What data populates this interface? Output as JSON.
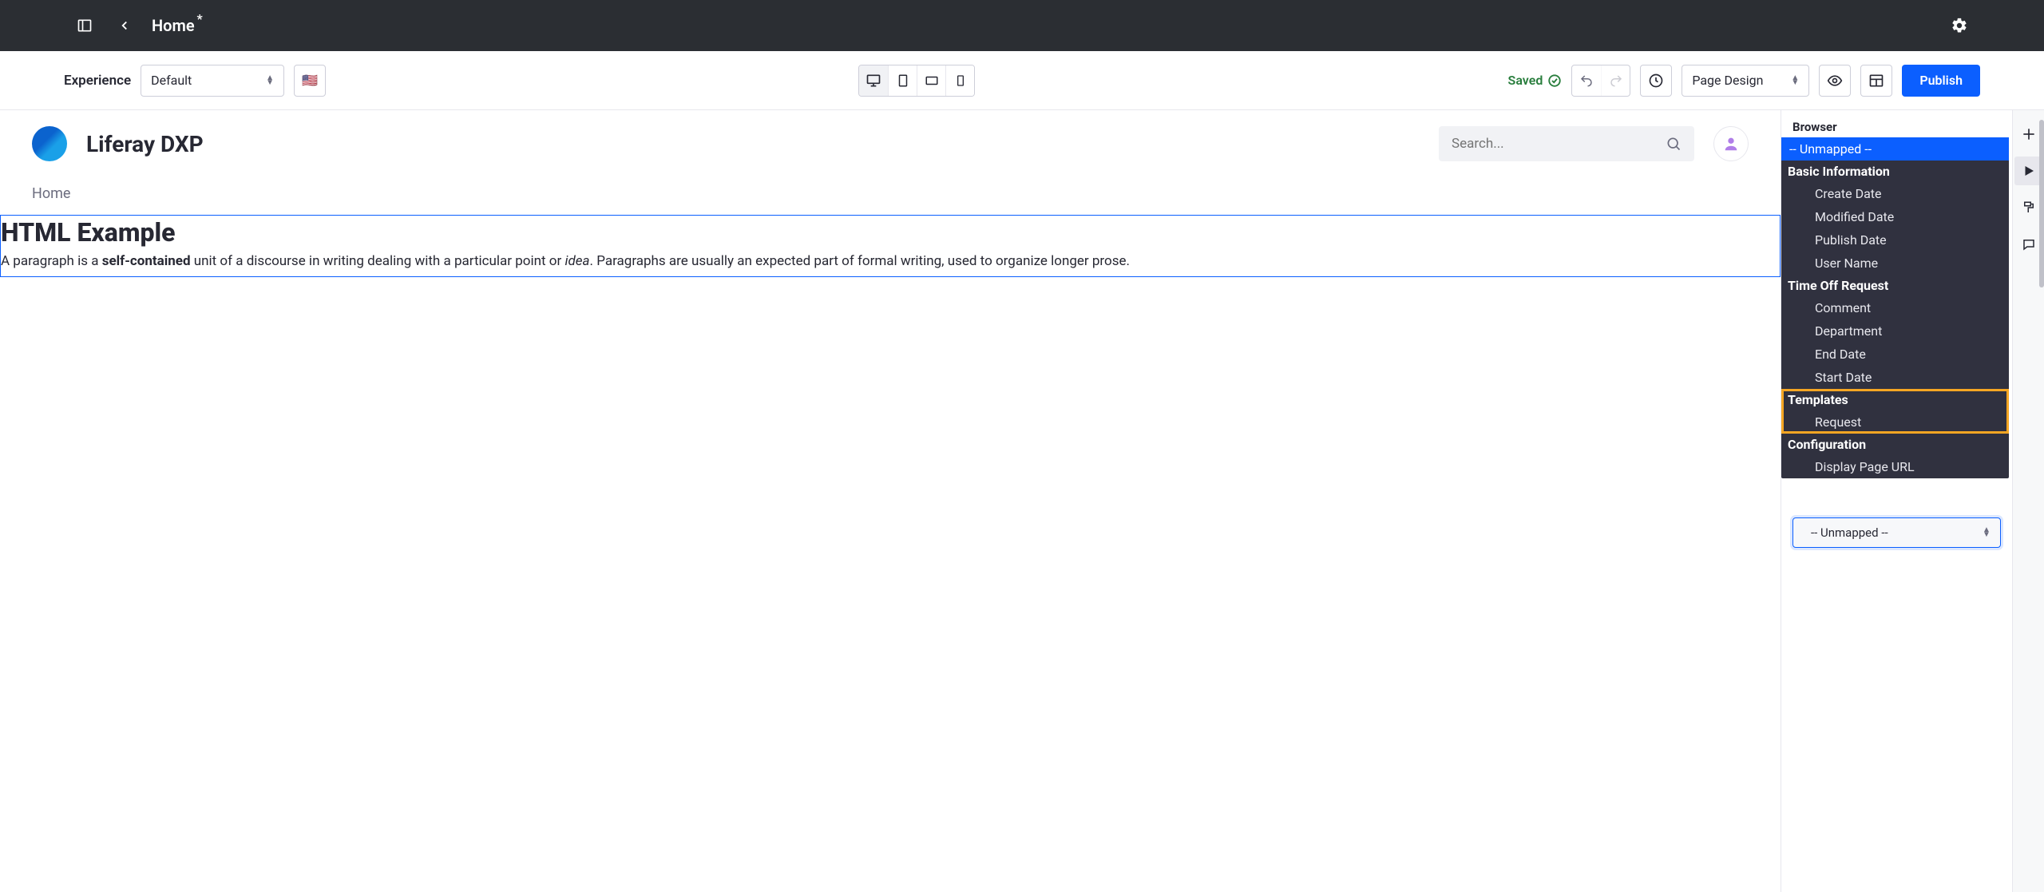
{
  "topbar": {
    "title": "Home",
    "modified_marker": "*"
  },
  "toolbar": {
    "experience_label": "Experience",
    "experience_value": "Default",
    "locale_flag": "🇺🇸",
    "saved_label": "Saved",
    "mode_select": "Page Design",
    "publish_label": "Publish"
  },
  "site": {
    "title": "Liferay DXP",
    "search_placeholder": "Search...",
    "nav_home": "Home"
  },
  "fragment": {
    "heading": "HTML Example",
    "para_prefix": "A paragraph is a ",
    "para_bold": "self-contained",
    "para_mid": " unit of a discourse in writing dealing with a particular point or ",
    "para_italic": "idea",
    "para_suffix": ". Paragraphs are usually an expected part of formal writing, used to organize longer prose."
  },
  "panel": {
    "title": "Browser",
    "field_select_value": "-- Unmapped --",
    "groups": [
      {
        "header": "-- Unmapped --",
        "selected": true
      },
      {
        "header": "Basic Information",
        "items": [
          "Create Date",
          "Modified Date",
          "Publish Date",
          "User Name"
        ]
      },
      {
        "header": "Time Off Request",
        "items": [
          "Comment",
          "Department",
          "End Date",
          "Start Date"
        ]
      },
      {
        "header": "Templates",
        "items": [
          "Request"
        ],
        "highlighted": true
      },
      {
        "header": "Configuration",
        "items": [
          "Display Page URL"
        ]
      }
    ]
  }
}
